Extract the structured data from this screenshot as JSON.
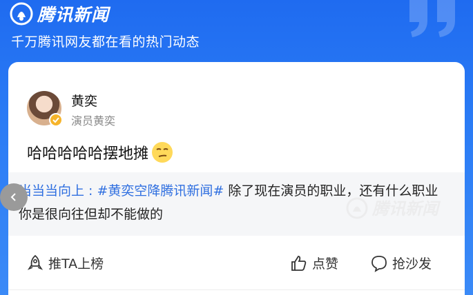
{
  "header": {
    "brand_name": "腾讯新闻",
    "subtitle": "千万腾讯网友都在看的热门动态"
  },
  "post": {
    "author_name": "黄奕",
    "author_role": "演员黄奕",
    "text": "哈哈哈哈哈摆地摊",
    "emoji": "smirk-face",
    "quote": {
      "user_link": "当当当向上 : ",
      "hashtag": "#黄奕空降腾讯新闻#",
      "body": " 除了现在演员的职业，还有什么职业你是很向往但却不能做的"
    },
    "watermark": "腾讯新闻"
  },
  "actions": {
    "promote_label": "推TA上榜",
    "like_label": "点赞",
    "comment_label": "抢沙发"
  },
  "colors": {
    "header_blue": "#1f6bf0",
    "link_blue": "#2f6fe0",
    "verified_gold": "#f6b42a",
    "quote_bg": "#f5f6f8"
  }
}
